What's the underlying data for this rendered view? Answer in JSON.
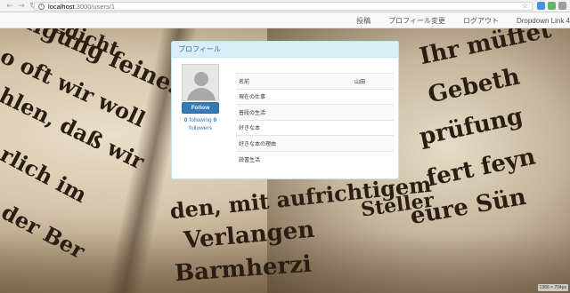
{
  "browser": {
    "nav": {
      "back": "←",
      "forward": "→",
      "reload": "↻"
    },
    "info_icon": "i",
    "url": {
      "host": "localhost",
      "path": ":3000/users/1"
    },
    "star_icon": "☆"
  },
  "navbar": {
    "links": [
      "投稿",
      "プロフィール変更",
      "ログアウト",
      "Dropdown Link 4"
    ]
  },
  "background": {
    "lines": [
      "Gedicht",
      "ndigung feines",
      "o oft wir woll",
      "hlen, daß wir",
      "rlich im",
      "der Ber",
      "Ihr müffet",
      "Gebeth",
      "prüfung",
      "fert feyn",
      "eure Sün",
      "den, mit aufrichtigem",
      "Verlangen",
      "Barmherzi",
      "Steller"
    ],
    "size_badge": "1366 × 704px"
  },
  "panel": {
    "title": "プロフィール",
    "follow_label": "Follow",
    "following_count": "0",
    "following_label": "following",
    "followers_count": "0",
    "followers_label": "followers",
    "rows": [
      {
        "label": "名前",
        "value": "山田"
      },
      {
        "label": "現在の仕事",
        "value": ""
      },
      {
        "label": "普段の生活",
        "value": ""
      },
      {
        "label": "好きな本",
        "value": ""
      },
      {
        "label": "好きな本の理由",
        "value": ""
      },
      {
        "label": "読書生活",
        "value": ""
      }
    ]
  }
}
